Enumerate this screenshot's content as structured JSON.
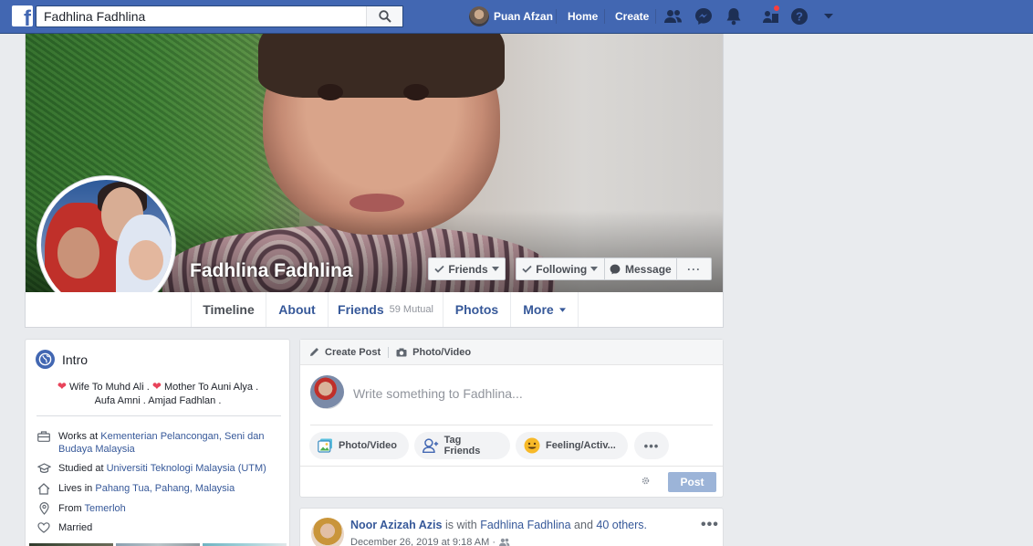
{
  "topbar": {
    "logo": "f",
    "search_value": "Fadhlina Fadhlina",
    "user_name": "Puan Afzan",
    "home_label": "Home",
    "create_label": "Create",
    "icons": [
      "friend-requests-icon",
      "messenger-icon",
      "notifications-icon",
      "groups-icon",
      "help-icon",
      "dropdown-arrow-icon"
    ],
    "brand_color": "#4267b2"
  },
  "profile": {
    "name": "Fadhlina Fadhlina",
    "friends_button": "Friends",
    "following_button": "Following",
    "message_button": "Message",
    "more_button": "···"
  },
  "tabs": [
    {
      "label": "Timeline"
    },
    {
      "label": "About"
    },
    {
      "label": "Friends",
      "sub": "59 Mutual"
    },
    {
      "label": "Photos"
    },
    {
      "label": "More"
    }
  ],
  "intro": {
    "title": "Intro",
    "bio_line1_a": "Wife To Muhd Ali .",
    "bio_line1_b": "Mother To Auni Alya .",
    "bio_line2": "Aufa Amni . Amjad Fadhlan .",
    "work_prefix": "Works at",
    "work_link": "Kementerian Pelancongan, Seni dan Budaya Malaysia",
    "study_prefix": "Studied at",
    "study_link": "Universiti Teknologi Malaysia (UTM)",
    "lives_prefix": "Lives in",
    "lives_link": "Pahang Tua, Pahang, Malaysia",
    "from_prefix": "From",
    "from_link": "Temerloh",
    "relationship": "Married"
  },
  "composer": {
    "create_post": "Create Post",
    "photo_video_tab": "Photo/Video",
    "placeholder": "Write something to Fadhlina...",
    "btn_photo": "Photo/Video",
    "btn_tag": "Tag Friends",
    "btn_feeling": "Feeling/Activ...",
    "btn_more": "•••",
    "post_button": "Post"
  },
  "post": {
    "author": "Noor Azizah Azis",
    "is_with": "is with",
    "tagged": "Fadhlina Fadhlina",
    "and": "and",
    "others": "40 others.",
    "timestamp": "December 26, 2019 at 9:18 AM ·",
    "more": "•••"
  }
}
